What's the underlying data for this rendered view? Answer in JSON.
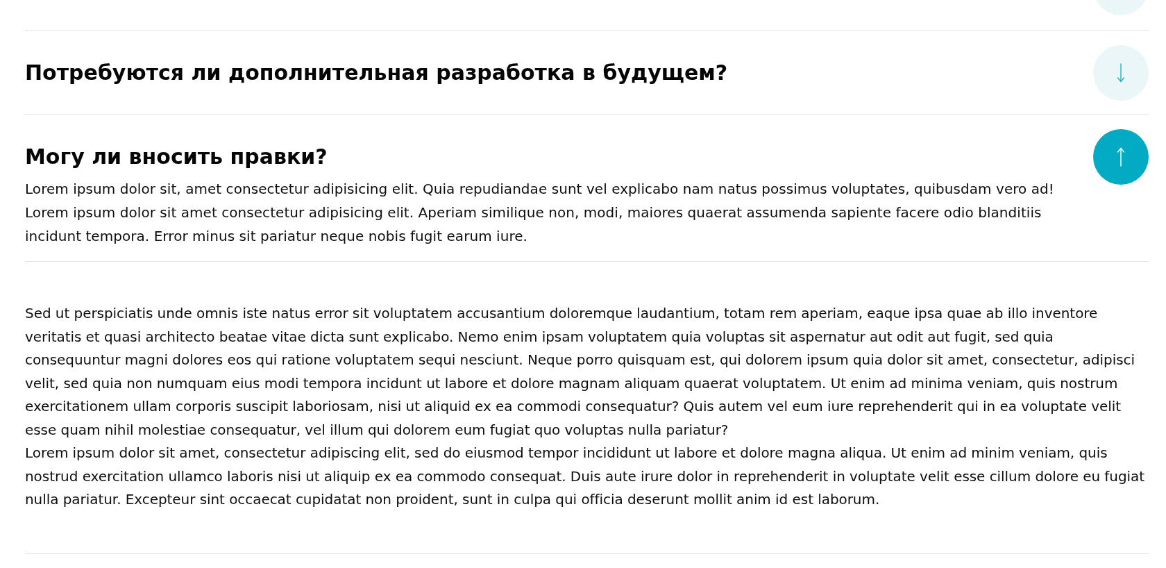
{
  "faq": {
    "previous_item": {
      "expanded": false
    },
    "items": [
      {
        "question": "Потребуются ли дополнительная разработка в будущем?",
        "expanded": false
      },
      {
        "question": "Могу ли вносить правки?",
        "expanded": true,
        "answer": [
          "Lorem ipsum dolor sit, amet consectetur adipisicing elit. Quia repudiandae sunt vel explicabo nam natus possimus voluptates, quibusdam vero ad!",
          "Lorem ipsum dolor sit amet consectetur adipisicing elit. Aperiam similique non, modi, maiores quaerat assumenda sapiente facere odio blanditiis incidunt tempora. Error minus sit pariatur neque nobis fugit earum iure."
        ]
      }
    ]
  },
  "description": {
    "paragraphs": [
      "Sed ut perspiciatis unde omnis iste natus error sit voluptatem accusantium doloremque laudantium, totam rem aperiam, eaque ipsa quae ab illo inventore veritatis et quasi architecto beatae vitae dicta sunt explicabo. Nemo enim ipsam voluptatem quia voluptas sit aspernatur aut odit aut fugit, sed quia consequuntur magni dolores eos qui ratione voluptatem sequi nesciunt. Neque porro quisquam est, qui dolorem ipsum quia dolor sit amet, consectetur, adipisci velit, sed quia non numquam eius modi tempora incidunt ut labore et dolore magnam aliquam quaerat voluptatem. Ut enim ad minima veniam, quis nostrum exercitationem ullam corporis suscipit laboriosam, nisi ut aliquid ex ea commodi consequatur? Quis autem vel eum iure reprehenderit qui in ea voluptate velit esse quam nihil molestiae consequatur, vel illum qui dolorem eum fugiat quo voluptas nulla pariatur?",
      "Lorem ipsum dolor sit amet, consectetur adipiscing elit, sed do eiusmod tempor incididunt ut labore et dolore magna aliqua. Ut enim ad minim veniam, quis nostrud exercitation ullamco laboris nisi ut aliquip ex ea commodo consequat. Duis aute irure dolor in reprehenderit in voluptate velit esse cillum dolore eu fugiat nulla pariatur. Excepteur sint occaecat cupidatat non proident, sunt in culpa qui officia deserunt mollit anim id est laborum."
    ]
  }
}
